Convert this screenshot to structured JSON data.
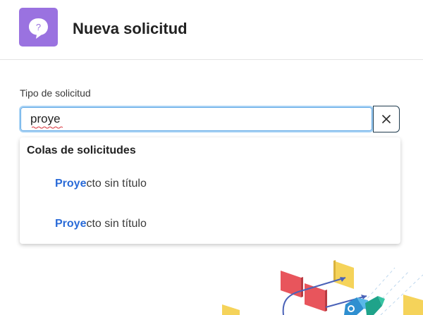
{
  "header": {
    "title": "Nueva solicitud",
    "app_icon": "chat-question-icon",
    "app_icon_glyph": "?",
    "accent_color": "#9a72e0"
  },
  "form": {
    "field_label": "Tipo de solicitud",
    "search_value": "proye",
    "focus_color": "#a9d3f5"
  },
  "dropdown": {
    "heading": "Colas de solicitudes",
    "options": [
      {
        "match": "Proye",
        "rest": "cto sin título"
      },
      {
        "match": "Proye",
        "rest": "cto sin título"
      }
    ],
    "match_color": "#2a6bd8"
  },
  "icons": {
    "clear": "close-icon"
  }
}
